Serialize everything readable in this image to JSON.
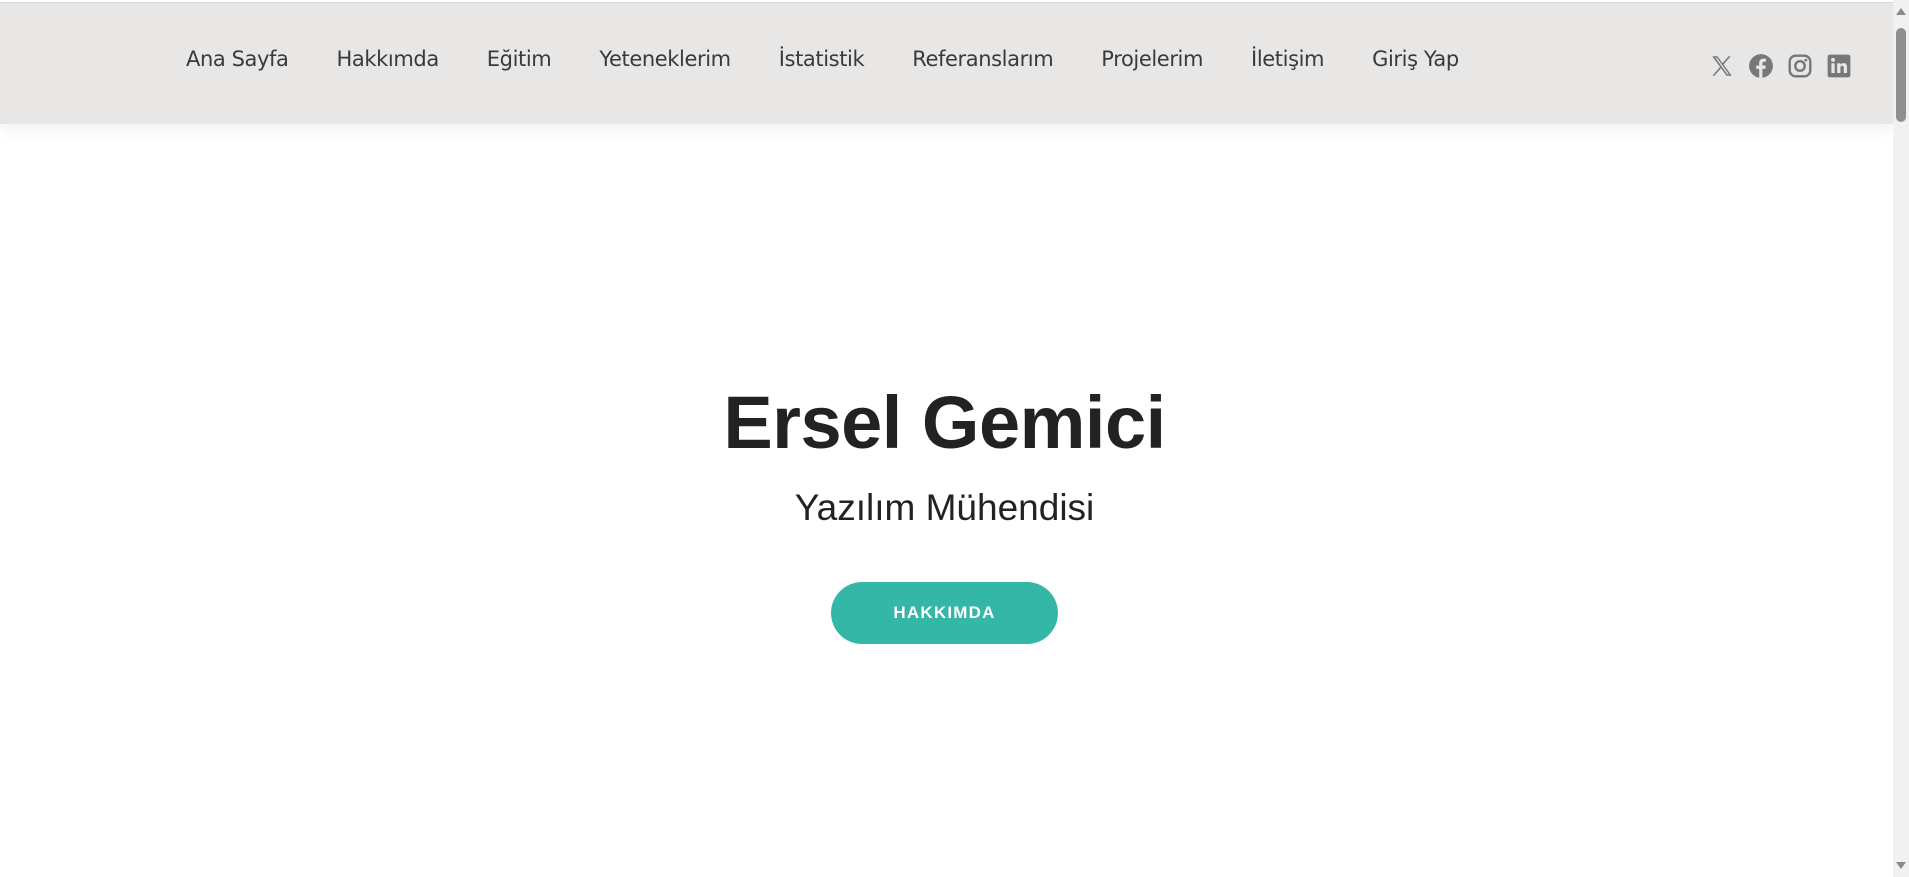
{
  "nav": {
    "items": [
      {
        "label": "Ana Sayfa"
      },
      {
        "label": "Hakkımda"
      },
      {
        "label": "Eğitim"
      },
      {
        "label": "Yeteneklerim"
      },
      {
        "label": "İstatistik"
      },
      {
        "label": "Referanslarım"
      },
      {
        "label": "Projelerim"
      },
      {
        "label": "İletişim"
      },
      {
        "label": "Giriş Yap"
      }
    ],
    "social_icons": [
      "x-twitter-icon",
      "facebook-icon",
      "instagram-icon",
      "linkedin-icon"
    ]
  },
  "hero": {
    "title": "Ersel Gemici",
    "subtitle": "Yazılım Mühendisi",
    "button_label": "HAKKIMDA"
  },
  "colors": {
    "nav_background": "#e8e7e6",
    "nav_text": "#3a3a3a",
    "accent": "#34b7a7",
    "heading": "#222222",
    "social_icon": "#777777"
  }
}
